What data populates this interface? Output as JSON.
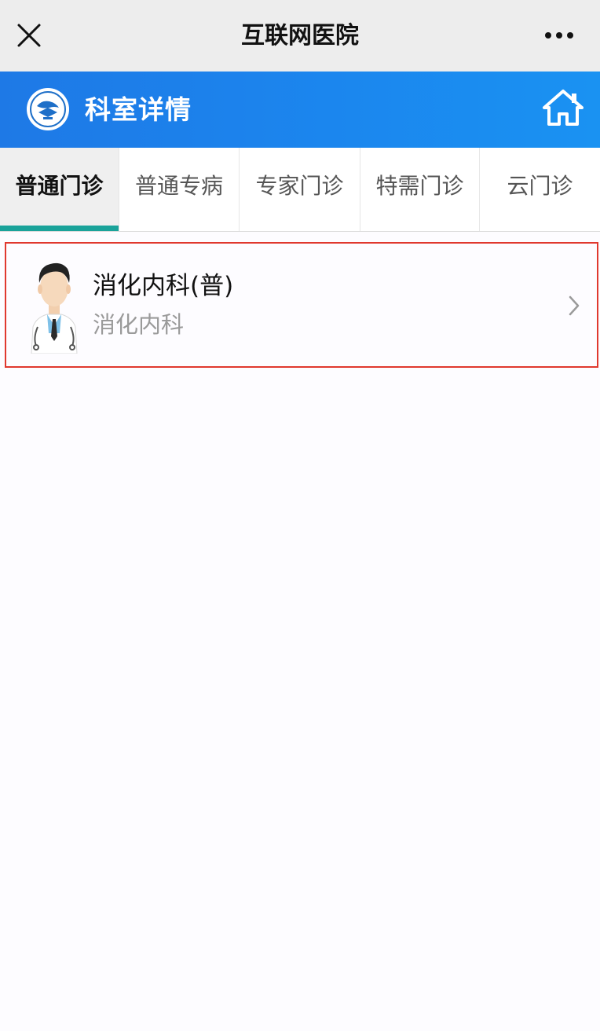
{
  "navbar": {
    "title": "互联网医院",
    "close_icon": "close-icon",
    "more_icon": "more-dots-icon"
  },
  "header": {
    "title": "科室详情",
    "logo_icon": "hospital-logo-icon",
    "home_icon": "home-icon",
    "background_color": "#1b86ee"
  },
  "tabs": [
    {
      "label": "普通门诊",
      "active": true
    },
    {
      "label": "普通专病",
      "active": false
    },
    {
      "label": "专家门诊",
      "active": false
    },
    {
      "label": "特需门诊",
      "active": false
    },
    {
      "label": "云门诊",
      "active": false
    }
  ],
  "tab_active_indicator_color": "#1aa39a",
  "departments": [
    {
      "name": "消化内科(普)",
      "category": "消化内科",
      "avatar_icon": "doctor-avatar-icon",
      "chevron_icon": "chevron-right-icon"
    }
  ],
  "highlight_border_color": "#e0382e"
}
